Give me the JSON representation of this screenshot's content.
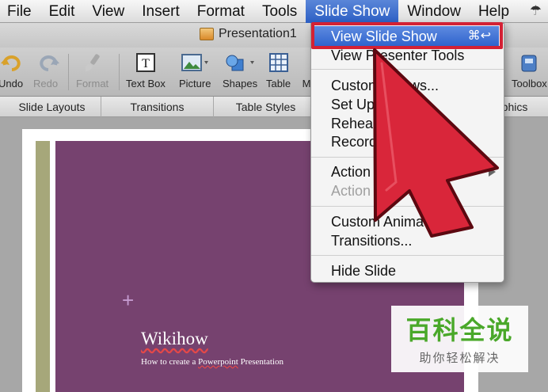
{
  "menubar": {
    "items": [
      "File",
      "Edit",
      "View",
      "Insert",
      "Format",
      "Tools",
      "Slide Show",
      "Window",
      "Help"
    ],
    "active_item": "Slide Show",
    "right_glyph": "☂"
  },
  "window": {
    "title": "Presentation1"
  },
  "toolbar": {
    "undo": "Undo",
    "redo": "Redo",
    "format": "Format",
    "text_box": "Text Box",
    "picture": "Picture",
    "shapes": "Shapes",
    "table": "Table",
    "media_partial": "M",
    "toolbox": "Toolbox"
  },
  "ribbon": {
    "tabs": [
      "Slide Layouts",
      "Transitions",
      "Table Styles",
      "phics"
    ]
  },
  "slide_show_menu": {
    "items": [
      {
        "label": "View Slide Show",
        "shortcut": "⌘↩",
        "state": "highlighted"
      },
      {
        "label": "View Presenter Tools",
        "state": "enabled"
      },
      {
        "label": "Custom Shows...",
        "state": "enabled"
      },
      {
        "label": "Set Up Show...",
        "state": "enabled"
      },
      {
        "label": "Rehearse Timings",
        "state": "enabled"
      },
      {
        "label": "Record Narration...",
        "state": "enabled"
      },
      {
        "label": "Action Buttons",
        "state": "enabled",
        "submenu": true
      },
      {
        "label": "Action Settings...",
        "state": "disabled"
      },
      {
        "label": "Custom Animation...",
        "state": "enabled"
      },
      {
        "label": "Transitions...",
        "state": "enabled"
      },
      {
        "label": "Hide Slide",
        "state": "enabled"
      }
    ]
  },
  "slide": {
    "title": "Wikihow",
    "subtitle_pre": "How to create a ",
    "subtitle_mark": "Powerpoint",
    "subtitle_post": " Presentation",
    "placeholder_glyph": "+",
    "background_color": "#76426f"
  },
  "watermark": {
    "logo": "百科全说",
    "tagline": "助你轻松解决"
  },
  "colors": {
    "menu_highlight": "#2d62cc",
    "annotation_red": "#d32134"
  }
}
